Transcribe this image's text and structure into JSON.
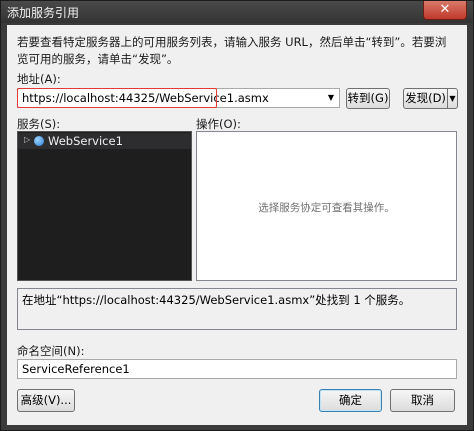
{
  "window": {
    "title": "添加服务引用",
    "close_glyph": "✕"
  },
  "description": "若要查看特定服务器上的可用服务列表，请输入服务 URL，然后单击“转到”。若要浏览可用的服务，请单击“发现”。",
  "address": {
    "label": "地址(A):",
    "value": "https://localhost:44325/WebService1.asmx",
    "go_button": "转到(G)",
    "discover_button": "发现(D)"
  },
  "services": {
    "label": "服务(S):",
    "items": [
      {
        "label": "WebService1",
        "icon": "globe-icon",
        "expander": "▷"
      }
    ]
  },
  "operations": {
    "label": "操作(O):",
    "empty_text": "选择服务协定可查看其操作。"
  },
  "status_text": "在地址“https://localhost:44325/WebService1.asmx”处找到 1 个服务。",
  "namespace": {
    "label": "命名空间(N):",
    "value": "ServiceReference1"
  },
  "footer": {
    "advanced_button": "高级(V)...",
    "ok_button": "确定",
    "cancel_button": "取消"
  },
  "colors": {
    "highlight_border": "#e53935",
    "tree_background": "#1e1e1e"
  }
}
